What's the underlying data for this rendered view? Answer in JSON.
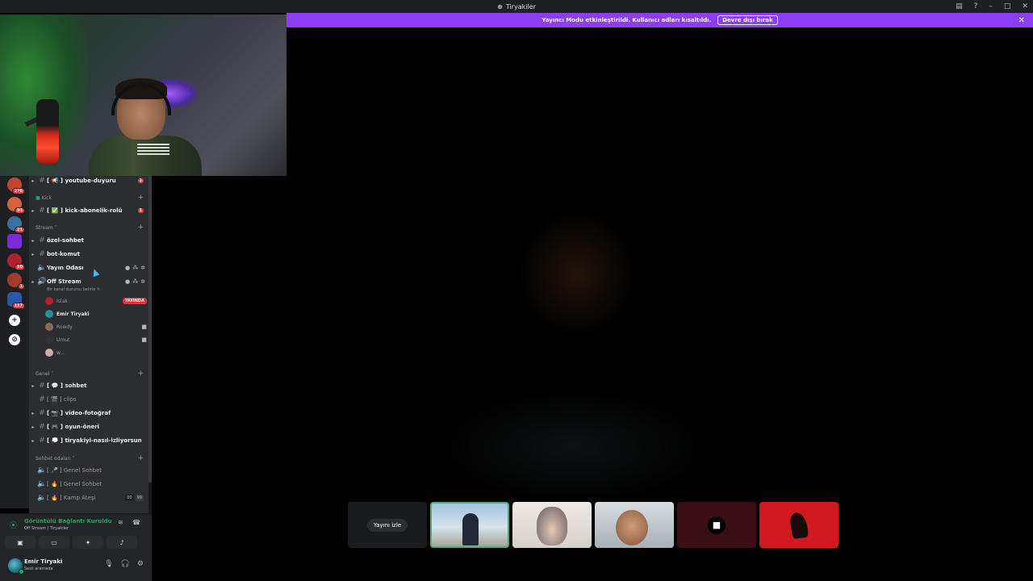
{
  "window": {
    "title": "Tiryakiler"
  },
  "banner": {
    "text": "Yayıncı Modu etkinleştirildi. Kullanıcı adları kısaltıldı.",
    "button": "Devre dışı bırak"
  },
  "servers": [
    {
      "badge": "276",
      "color": "#c2462f"
    },
    {
      "badge": "93",
      "color": "#d4643a"
    },
    {
      "badge": "21",
      "color": "#3b6f9e"
    },
    {
      "badge": "",
      "color": "#7a2bd1"
    },
    {
      "badge": "10",
      "color": "#b0202d"
    },
    {
      "badge": "1",
      "color": "#a23c2a"
    },
    {
      "badge": "117",
      "color": "#2a58a8"
    }
  ],
  "channels": {
    "youtube_duyuru": {
      "prefix": "[ 📢 ]",
      "name": "youtube-duyuru",
      "mentions": "1"
    },
    "cat_kick": "Kick",
    "kick_abonelik": {
      "prefix": "[ ✅ ]",
      "name": "kick-abonelik-rolü",
      "mentions": "1"
    },
    "cat_stream": "Stream",
    "ozel_sohbet": "özel-sohbet",
    "bot_komut": "bot-komut",
    "yayin_odasi": "Yayın Odası",
    "off_stream": "Off Stream",
    "off_stream_status": "Bir kanal durumu belirle",
    "voice_users": [
      {
        "name": "Islak",
        "live": "YAYINDA",
        "color": "#b0202d"
      },
      {
        "name": "Emir Tiryaki",
        "live": "",
        "color": "#2a8a9e"
      },
      {
        "name": "Rowdy",
        "live": "",
        "color": "#8a6a5a"
      },
      {
        "name": "Umut",
        "live": "",
        "color": "#333"
      },
      {
        "name": "w...",
        "live": "",
        "color": "#caa"
      }
    ],
    "cat_genel": "Genel",
    "sohbet": {
      "prefix": "[ 💬 ]",
      "name": "sohbet"
    },
    "clips": {
      "prefix": "[ 🎬 ]",
      "name": "clips"
    },
    "video_fotograf": {
      "prefix": "[ 📷 ]",
      "name": "video-fotoğraf"
    },
    "oyun_oneri": {
      "prefix": "[ 🎮 ]",
      "name": "oyun-öneri"
    },
    "tiryakiyi": {
      "prefix": "[ 💭 ]",
      "name": "tiryakiyi-nasıl-izliyorsun"
    },
    "cat_sohbet_odalari": "Sohbet odaları",
    "genel_sohbet_1": {
      "prefix": "[ 🎤 ]",
      "name": "Genel Sohbet"
    },
    "genel_sohbet_2": {
      "prefix": "[ 🔥 ]",
      "name": "Genel Sohbet"
    },
    "kamp_atesi": {
      "prefix": "[ 🔥 ]",
      "name": "Kamp Ateşi",
      "count_a": "00",
      "count_b": "99"
    }
  },
  "voice_panel": {
    "status": "Görüntülü Bağlantı Kuruldu",
    "location": "Off Stream / Tiryakiler"
  },
  "user_panel": {
    "name": "Emir Tiryaki",
    "status": "Sesli aramada"
  },
  "tiles": {
    "watch_label": "Yayını izle"
  },
  "colors": {
    "banner": "#8c3ef0",
    "online": "#23a55a",
    "mention": "#f23f42",
    "live": "#da373c"
  }
}
